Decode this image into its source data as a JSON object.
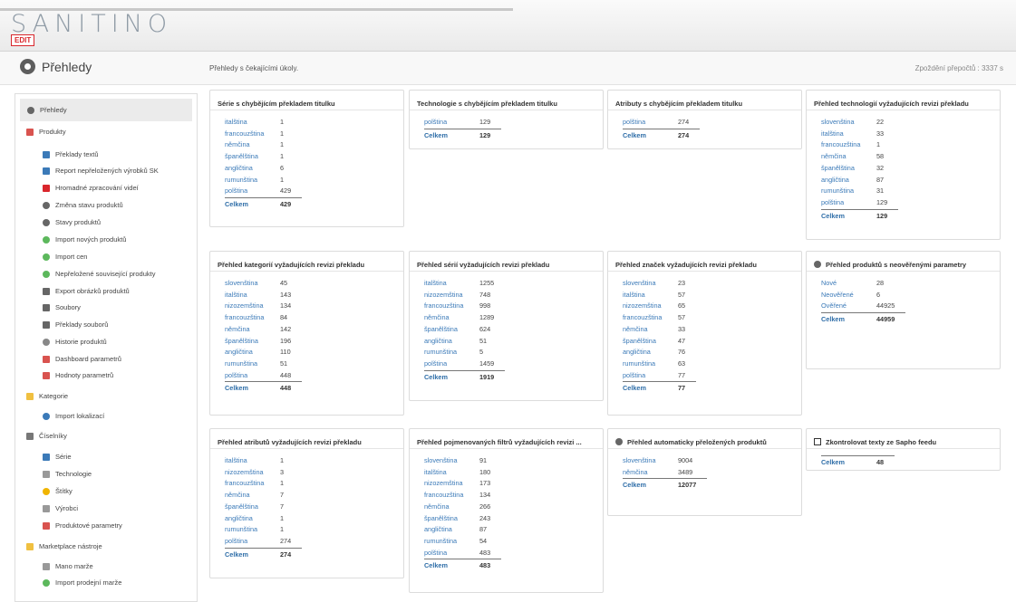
{
  "app": {
    "logo": "SANITINO",
    "edit_badge": "EDIT"
  },
  "header": {
    "title": "Přehledy",
    "subtitle": "Přehledy s čekajícími úkoly.",
    "delay": "Zpoždění přepočtů : 3337 s"
  },
  "sidebar": {
    "items": [
      {
        "label": "Přehledy",
        "icon": "gauge-icon",
        "color": "#666666"
      },
      {
        "label": "Produkty",
        "icon": "product-icon",
        "color": "#d9534f"
      },
      {
        "label": "Překlady textů",
        "icon": "translate-icon",
        "color": "#3b7ab8"
      },
      {
        "label": "Report nepřeložených výrobků SK",
        "icon": "report-icon",
        "color": "#3b7ab8"
      },
      {
        "label": "Hromadné zpracování videí",
        "icon": "video-icon",
        "color": "#d9262c"
      },
      {
        "label": "Změna stavu produktů",
        "icon": "gauge-icon",
        "color": "#666666"
      },
      {
        "label": "Stavy produktů",
        "icon": "gauge-icon",
        "color": "#666666"
      },
      {
        "label": "Import nových produktů",
        "icon": "import-icon",
        "color": "#5cb85c"
      },
      {
        "label": "Import cen",
        "icon": "price-icon",
        "color": "#5cb85c"
      },
      {
        "label": "Nepřeložené související produkty",
        "icon": "link-icon",
        "color": "#5cb85c"
      },
      {
        "label": "Export obrázků produktů",
        "icon": "image-icon",
        "color": "#666666"
      },
      {
        "label": "Soubory",
        "icon": "file-icon",
        "color": "#666666"
      },
      {
        "label": "Překlady souborů",
        "icon": "file-icon",
        "color": "#666666"
      },
      {
        "label": "Historie produktů",
        "icon": "history-icon",
        "color": "#888888"
      },
      {
        "label": "Dashboard parametrů",
        "icon": "dashboard-icon",
        "color": "#d9534f"
      },
      {
        "label": "Hodnoty parametrů",
        "icon": "values-icon",
        "color": "#d9534f"
      },
      {
        "label": "Kategorie",
        "icon": "folder-icon",
        "color": "#f0c040"
      },
      {
        "label": "Import lokalizací",
        "icon": "import-icon",
        "color": "#3b7ab8"
      },
      {
        "label": "Číselníky",
        "icon": "wrench-icon",
        "color": "#777777"
      },
      {
        "label": "Série",
        "icon": "series-icon",
        "color": "#3b7ab8"
      },
      {
        "label": "Technologie",
        "icon": "tech-icon",
        "color": "#999999"
      },
      {
        "label": "Štítky",
        "icon": "tag-icon",
        "color": "#f0b400"
      },
      {
        "label": "Výrobci",
        "icon": "maker-icon",
        "color": "#999999"
      },
      {
        "label": "Produktové parametry",
        "icon": "params-icon",
        "color": "#d9534f"
      },
      {
        "label": "Marketplace nástroje",
        "icon": "folder-icon",
        "color": "#f0c040"
      },
      {
        "label": "Mano marže",
        "icon": "margin-icon",
        "color": "#999999"
      },
      {
        "label": "Import prodejní marže",
        "icon": "import-icon",
        "color": "#5cb85c"
      }
    ]
  },
  "cards": [
    {
      "title": "Série s chybějícím překladem titulku",
      "rows": [
        [
          "italština",
          "1"
        ],
        [
          "francouzština",
          "1"
        ],
        [
          "němčina",
          "1"
        ],
        [
          "španělština",
          "1"
        ],
        [
          "angličtina",
          "6"
        ],
        [
          "rumunština",
          "1"
        ],
        [
          "polština",
          "429"
        ]
      ],
      "total": [
        "Celkem",
        "429"
      ]
    },
    {
      "title": "Technologie s chybějícím překladem titulku",
      "rows": [
        [
          "polština",
          "129"
        ]
      ],
      "total": [
        "Celkem",
        "129"
      ]
    },
    {
      "title": "Atributy s chybějícím překladem titulku",
      "rows": [
        [
          "polština",
          "274"
        ]
      ],
      "total": [
        "Celkem",
        "274"
      ]
    },
    {
      "title": "Přehled technologií vyžadujících revizi překladu",
      "rows": [
        [
          "slovenština",
          "22"
        ],
        [
          "italština",
          "33"
        ],
        [
          "francouzština",
          "1"
        ],
        [
          "němčina",
          "58"
        ],
        [
          "španělština",
          "32"
        ],
        [
          "angličtina",
          "87"
        ],
        [
          "rumunština",
          "31"
        ],
        [
          "polština",
          "129"
        ]
      ],
      "total": [
        "Celkem",
        "129"
      ]
    },
    {
      "title": "Přehled kategorií vyžadujících revizi překladu",
      "rows": [
        [
          "slovenština",
          "45"
        ],
        [
          "italština",
          "143"
        ],
        [
          "nizozemština",
          "134"
        ],
        [
          "francouzština",
          "84"
        ],
        [
          "němčina",
          "142"
        ],
        [
          "španělština",
          "196"
        ],
        [
          "angličtina",
          "110"
        ],
        [
          "rumunština",
          "51"
        ],
        [
          "polština",
          "448"
        ]
      ],
      "total": [
        "Celkem",
        "448"
      ]
    },
    {
      "title": "Přehled sérií vyžadujících revizi překladu",
      "rows": [
        [
          "italština",
          "1255"
        ],
        [
          "nizozemština",
          "748"
        ],
        [
          "francouzština",
          "998"
        ],
        [
          "němčina",
          "1289"
        ],
        [
          "španělština",
          "624"
        ],
        [
          "angličtina",
          "51"
        ],
        [
          "rumunština",
          "5"
        ],
        [
          "polština",
          "1459"
        ]
      ],
      "total": [
        "Celkem",
        "1919"
      ]
    },
    {
      "title": "Přehled značek vyžadujících revizi překladu",
      "rows": [
        [
          "slovenština",
          "23"
        ],
        [
          "italština",
          "57"
        ],
        [
          "nizozemština",
          "65"
        ],
        [
          "francouzština",
          "57"
        ],
        [
          "němčina",
          "33"
        ],
        [
          "španělština",
          "47"
        ],
        [
          "angličtina",
          "76"
        ],
        [
          "rumunština",
          "63"
        ],
        [
          "polština",
          "77"
        ]
      ],
      "total": [
        "Celkem",
        "77"
      ]
    },
    {
      "title": "Přehled produktů s neověřenými parametry",
      "icon": "gauge-icon",
      "rows": [
        [
          "Nové",
          "28"
        ],
        [
          "Neověřené",
          "6"
        ],
        [
          "Ověřené",
          "44925"
        ]
      ],
      "total": [
        "Celkem",
        "44959"
      ]
    },
    {
      "title": "Přehled atributů vyžadujících revizi překladu",
      "rows": [
        [
          "italština",
          "1"
        ],
        [
          "nizozemština",
          "3"
        ],
        [
          "francouzština",
          "1"
        ],
        [
          "němčina",
          "7"
        ],
        [
          "španělština",
          "7"
        ],
        [
          "angličtina",
          "1"
        ],
        [
          "rumunština",
          "1"
        ],
        [
          "polština",
          "274"
        ]
      ],
      "total": [
        "Celkem",
        "274"
      ]
    },
    {
      "title": "Přehled pojmenovaných filtrů vyžadujících revizi ...",
      "rows": [
        [
          "slovenština",
          "91"
        ],
        [
          "italština",
          "180"
        ],
        [
          "nizozemština",
          "173"
        ],
        [
          "francouzština",
          "134"
        ],
        [
          "němčina",
          "266"
        ],
        [
          "španělština",
          "243"
        ],
        [
          "angličtina",
          "87"
        ],
        [
          "rumunština",
          "54"
        ],
        [
          "polština",
          "483"
        ]
      ],
      "total": [
        "Celkem",
        "483"
      ]
    },
    {
      "title": "Přehled automaticky přeložených produktů",
      "icon": "gauge-icon",
      "rows": [
        [
          "slovenština",
          "9004"
        ],
        [
          "němčina",
          "3489"
        ]
      ],
      "total": [
        "Celkem",
        "12077"
      ]
    },
    {
      "title": "Zkontrolovat texty ze Sapho feedu",
      "icon": "checkbox-icon",
      "rows": [],
      "total": [
        "Celkem",
        "48"
      ]
    }
  ]
}
